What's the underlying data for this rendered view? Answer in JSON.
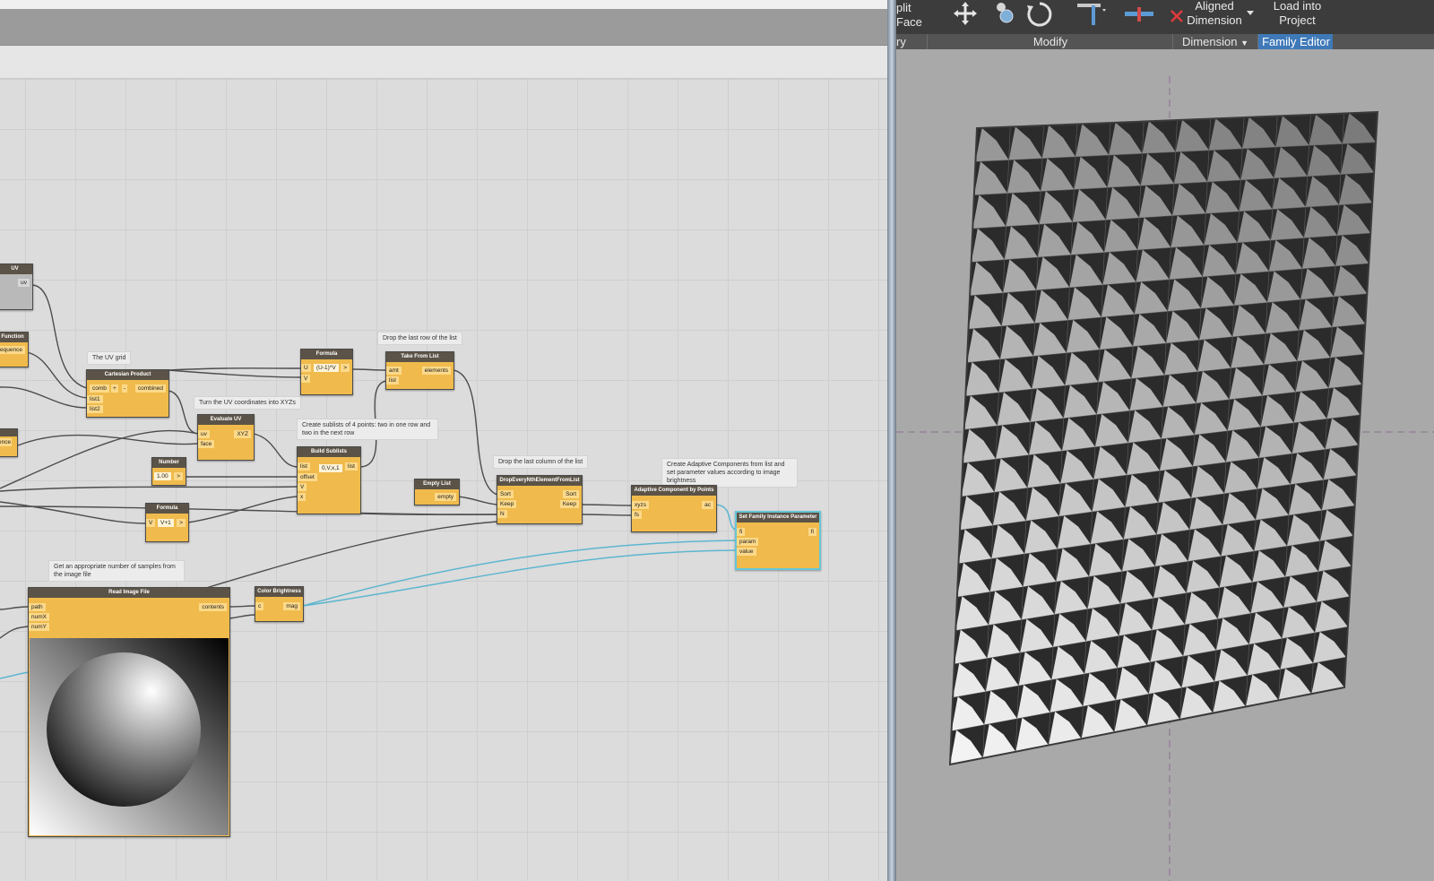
{
  "notes": {
    "uv_grid": "The UV grid",
    "uv_to_xyz": "Turn the UV coordinates into XYZs",
    "drop_last_row": "Drop the last row of the list",
    "sublists": "Create sublists of 4 points: two in one row and two in the next row",
    "drop_last_col": "Drop the last column of the list",
    "create_ac": "Create Adaptive Components from list and set parameter values according to image brightness",
    "samples": "Get an appropriate number of samples from the image file"
  },
  "nodes": {
    "uv": {
      "title": "UV",
      "out": "uv"
    },
    "seq": {
      "title": "Function",
      "in": "equence"
    },
    "seq2": {
      "in": "ence"
    },
    "cartesian": {
      "title": "Cartesian Product",
      "in1": "comb",
      "plus": "+",
      "minus": "-",
      "in2": "list1",
      "in3": "list2",
      "out": "combined"
    },
    "formula1": {
      "title": "Formula",
      "in1": "U",
      "in2": "V",
      "expr": "(U-1)*V",
      "out": ">"
    },
    "take": {
      "title": "Take From List",
      "in1": "amt",
      "in2": "list",
      "out": "elements"
    },
    "evaluate": {
      "title": "Evaluate UV",
      "in1": "uv",
      "in2": "face",
      "out": "XYZ"
    },
    "number": {
      "title": "Number",
      "value": "1.00",
      "out": ">"
    },
    "formula2": {
      "title": "Formula",
      "in1": "V",
      "expr": "V+1",
      "out": ">"
    },
    "sublists": {
      "title": "Build Sublists",
      "in1": "list",
      "in2": "offset",
      "in3": "V",
      "in4": "x",
      "expr": "0,V,x,1",
      "out": "list"
    },
    "empty": {
      "title": "Empty List",
      "out": "empty"
    },
    "dropnth": {
      "title": "DropEveryNthElementFromList",
      "in1": "Sort",
      "in2": "Keep",
      "in3": "N",
      "out1": "Sort",
      "out2": "Keep"
    },
    "adaptive": {
      "title": "Adaptive Component by Points",
      "in1": "xyzs",
      "in2": "fs",
      "out": "ac"
    },
    "setparam": {
      "title": "Set Family Instance Parameter",
      "in1": "fi",
      "in2": "param",
      "in3": "value",
      "out": "fi"
    },
    "readimg": {
      "title": "Read Image File",
      "in1": "path",
      "in2": "numX",
      "in3": "numY",
      "out": "contents"
    },
    "brightness": {
      "title": "Color Brightness",
      "in1": "c",
      "out": "mag"
    }
  },
  "ribbon": {
    "split_face": "plit Face",
    "aligned": "Aligned",
    "dimension": "Dimension",
    "load_into": "Load into",
    "project": "Project"
  },
  "panels": {
    "geometry": "ry",
    "modify": "Modify",
    "dimension": "Dimension",
    "family_editor": "Family Editor"
  }
}
